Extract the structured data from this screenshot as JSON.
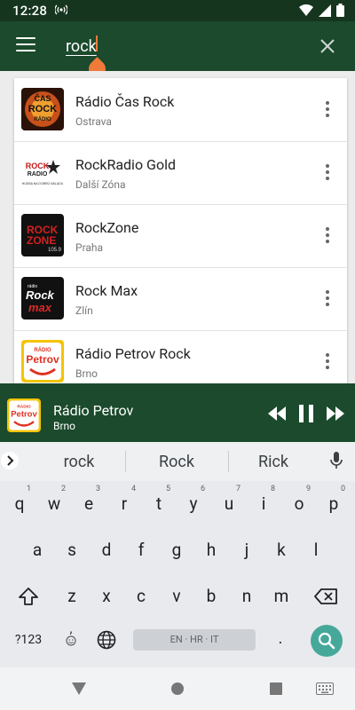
{
  "status": {
    "time": "12:28"
  },
  "search": {
    "query": "rock"
  },
  "results": [
    {
      "name": "Rádio Čas Rock",
      "city": "Ostrava"
    },
    {
      "name": "RockRadio Gold",
      "city": "Další Zóna"
    },
    {
      "name": "RockZone",
      "city": "Praha"
    },
    {
      "name": "Rock Max",
      "city": "Zlín"
    },
    {
      "name": "Rádio Petrov Rock",
      "city": "Brno"
    }
  ],
  "logos": {
    "cas_line1": "ČAS",
    "cas_line2": "ROCK",
    "cas_line3": "RÁDIO",
    "rr_line1": "ROCK",
    "rr_line2": "RADIO",
    "rr_tag": "HUDBA NA DOBRÚ NÁLADU",
    "rz_line1": "ROCK",
    "rz_line2": "ZONE",
    "rz_freq": "105.9",
    "rm_line1": "rádio",
    "rm_line2": "Rock",
    "rm_line3": "max",
    "petrov_small": "RÁDIO",
    "petrov_name": "Petrov"
  },
  "player": {
    "title": "Rádio Petrov",
    "subtitle": "Brno"
  },
  "keyboard": {
    "suggestions": [
      "rock",
      "Rock",
      "Rick"
    ],
    "row1": [
      "q",
      "w",
      "e",
      "r",
      "t",
      "y",
      "u",
      "i",
      "o",
      "p"
    ],
    "row1_hints": [
      "1",
      "2",
      "3",
      "4",
      "5",
      "6",
      "7",
      "8",
      "9",
      "0"
    ],
    "row2": [
      "a",
      "s",
      "d",
      "f",
      "g",
      "h",
      "j",
      "k",
      "l"
    ],
    "row3": [
      "z",
      "x",
      "c",
      "v",
      "b",
      "n",
      "m"
    ],
    "symbols_key": "?123",
    "emoji_hint": ",",
    "period": ".",
    "space_label": "EN · HR · IT"
  },
  "colors": {
    "header": "#1b4a2c",
    "accent": "#f07a3a",
    "enter": "#46a89a"
  }
}
